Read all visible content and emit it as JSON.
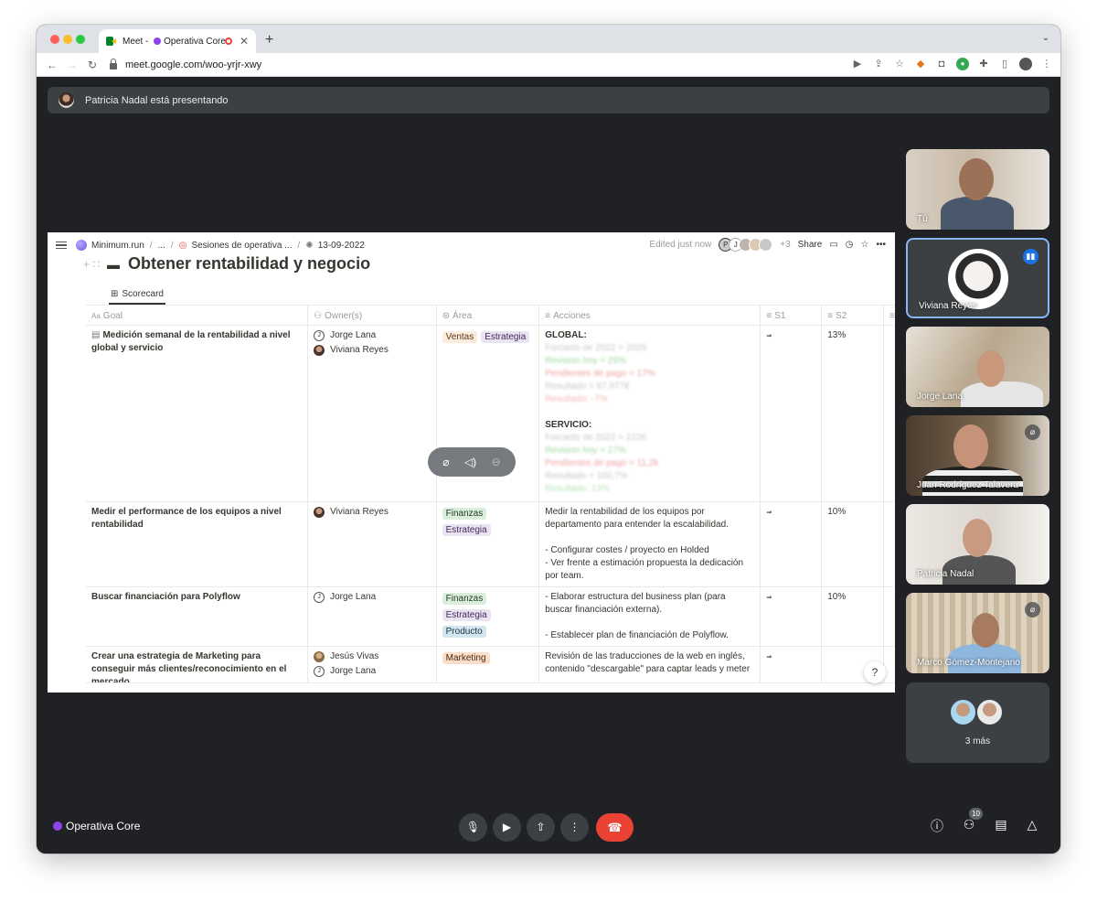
{
  "browser": {
    "tab_title_prefix": "Meet - ",
    "tab_title_suffix": "Operativa Core",
    "tab_close": "✕",
    "new_tab": "+",
    "url": "meet.google.com/woo-yrjr-xwy"
  },
  "presenting": {
    "text": "Patricia Nadal está presentando"
  },
  "doc": {
    "breadcrumb": [
      "Minimum.run",
      "...",
      "Sesiones de operativa ...",
      "13-09-2022"
    ],
    "edited": "Edited just now",
    "avatar_initials": [
      "P",
      "J"
    ],
    "extra_count": "+3",
    "share": "Share",
    "title": "Obtener rentabilidad y negocio",
    "view_tab": "Scorecard",
    "columns": [
      "Goal",
      "Owner(s)",
      "Área",
      "Acciones",
      "S1",
      "S2"
    ],
    "rows": [
      {
        "goal": "Medición semanal de la rentabilidad a nivel global y servicio",
        "owners": [
          {
            "initial": "J",
            "name": "Jorge Lana",
            "kind": "j"
          },
          {
            "initial": "",
            "name": "Viviana Reyes",
            "kind": "v"
          }
        ],
        "tags": [
          {
            "label": "Ventas",
            "kind": "ventas"
          },
          {
            "label": "Estrategia",
            "kind": "estrat"
          }
        ],
        "acciones_heading_1": "GLOBAL:",
        "acciones_blur_1": [
          "Forcasts de 2022 = 2025",
          "Revision hoy = 25%",
          "Pendientes de pago = 17%",
          "Resultado = 87,977€",
          "Resultado: -7%"
        ],
        "acciones_heading_2": "SERVICIO:",
        "acciones_blur_2": [
          "Forcasts de 2022 = 2226",
          "Revision hoy = 27%",
          "Pendientes de pago = 11,2k",
          "Resultado = 100,7%",
          "Resultado: 13%"
        ],
        "s1": "soon",
        "s2": "13%"
      },
      {
        "goal": "Medir el performance de los equipos a nivel rentabilidad",
        "owners": [
          {
            "initial": "",
            "name": "Viviana Reyes",
            "kind": "v"
          }
        ],
        "tags": [
          {
            "label": "Finanzas",
            "kind": "fin"
          },
          {
            "label": "Estrategia",
            "kind": "estrat"
          }
        ],
        "acciones": [
          "Medir la rentabilidad de los equipos por departamento para entender la escalabilidad.",
          "",
          "- Configurar costes / proyecto en Holded",
          "- Ver frente a estimación propuesta la dedicación por team."
        ],
        "s1": "soon",
        "s2": "10%"
      },
      {
        "goal": "Buscar financiación para Polyflow",
        "owners": [
          {
            "initial": "J",
            "name": "Jorge Lana",
            "kind": "j"
          }
        ],
        "tags": [
          {
            "label": "Finanzas",
            "kind": "fin"
          },
          {
            "label": "Estrategia",
            "kind": "estrat"
          },
          {
            "label": "Producto",
            "kind": "prod"
          }
        ],
        "acciones": [
          "- Elaborar estructura del business plan (para buscar financiación externa).",
          "",
          "- Establecer plan de financiación de Polyflow."
        ],
        "s1": "soon",
        "s2": "10%"
      },
      {
        "goal": "Crear una estrategia de Marketing para conseguir más clientes/reconocimiento en el mercado",
        "owners": [
          {
            "initial": "",
            "name": "Jesús Vivas",
            "kind": "je"
          },
          {
            "initial": "J",
            "name": "Jorge Lana",
            "kind": "j"
          }
        ],
        "tags": [
          {
            "label": "Marketing",
            "kind": "mkt"
          }
        ],
        "acciones": [
          "Revisión de las traducciones de la web en inglés, contenido \"descargable\" para captar leads y meter"
        ],
        "s1": "soon",
        "s2": ""
      }
    ],
    "help": "?"
  },
  "participants": [
    {
      "name": "Tú",
      "muted": false,
      "speaking": false
    },
    {
      "name": "Viviana Reyes",
      "muted": false,
      "speaking": true
    },
    {
      "name": "Jorge Lana",
      "muted": false,
      "speaking": false
    },
    {
      "name": "Juan Rodríguez Talavera",
      "muted": true,
      "speaking": false
    },
    {
      "name": "Patricia Nadal",
      "muted": false,
      "speaking": false
    },
    {
      "name": "Marco Gómez-Montejano",
      "muted": true,
      "speaking": false
    }
  ],
  "more_tile": {
    "label": "3 más"
  },
  "bottom": {
    "meeting_name": "Operativa Core",
    "people_count": "10"
  },
  "colors": {
    "meet_bg": "#202124",
    "tile_bg": "#3c4043",
    "hangup": "#ea4335",
    "accent_blue": "#1a73e8",
    "meeting_dot": "#8e44ec"
  },
  "icons": [
    "lock-icon",
    "mic-icon",
    "camera-icon",
    "present-icon",
    "more-vert-icon",
    "hangup-icon",
    "info-icon",
    "people-icon",
    "chat-icon",
    "activities-icon"
  ]
}
